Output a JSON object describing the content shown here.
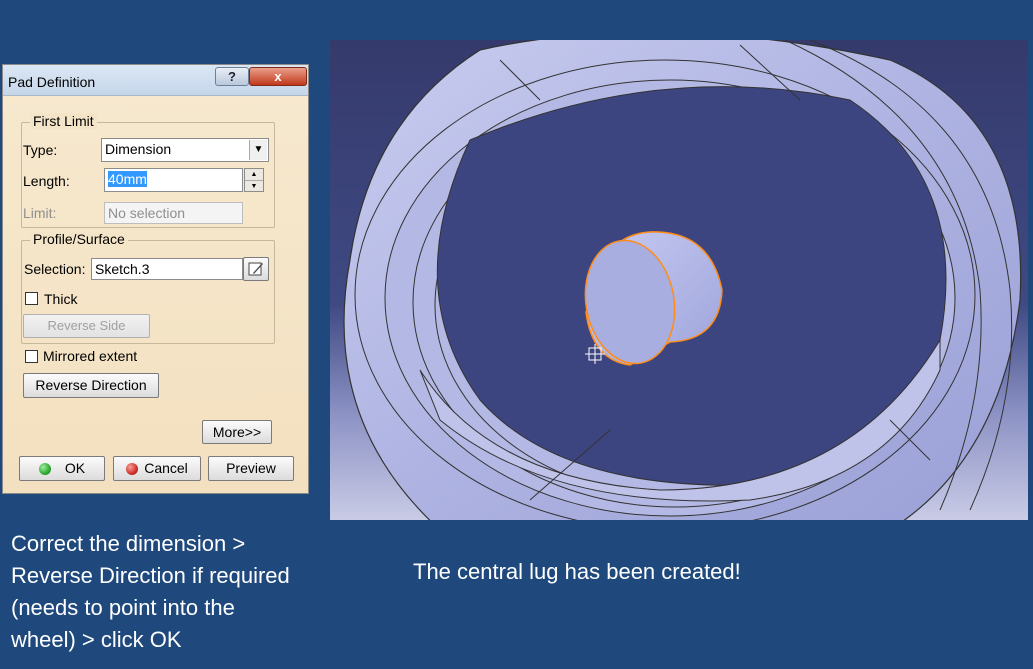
{
  "dialog": {
    "title": "Pad Definition",
    "help_label": "?",
    "close_label": "x",
    "first_limit": {
      "group_label": "First Limit",
      "type_label": "Type:",
      "type_value": "Dimension",
      "length_label": "Length:",
      "length_value": "40mm",
      "limit_label": "Limit:",
      "limit_value": "No selection"
    },
    "profile": {
      "group_label": "Profile/Surface",
      "selection_label": "Selection:",
      "selection_value": "Sketch.3",
      "thick_label": "Thick",
      "thick_checked": false,
      "reverse_side_label": "Reverse Side"
    },
    "mirrored_label": "Mirrored extent",
    "mirrored_checked": false,
    "reverse_direction_label": "Reverse Direction",
    "more_label": "More>>",
    "ok_label": "OK",
    "cancel_label": "Cancel",
    "preview_label": "Preview",
    "colors": {
      "ok_dot": "#2fa82f",
      "cancel_dot": "#d0302a"
    }
  },
  "captions": {
    "left": [
      "Correct the dimension >",
      "Reverse Direction if required",
      "(needs to point into the",
      "wheel) > click OK"
    ],
    "right": "The central lug has been created!"
  },
  "viewport": {
    "colors": {
      "part": "#b7bbe6",
      "highlight": "#ff8c1a",
      "bg_top": "#353a6c"
    }
  }
}
